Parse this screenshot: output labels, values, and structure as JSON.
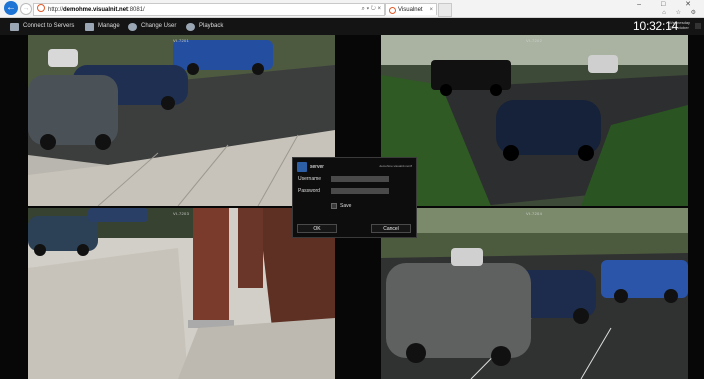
{
  "browser": {
    "url_prefix": "http://",
    "url_host": "demohme.visualnit.net",
    "url_suffix": ":8081/",
    "addr_controls": "⌕ ▾ ↻ ×",
    "tab_title": "Visualnet",
    "tab_close": "×",
    "back_glyph": "←",
    "forward_glyph": "→",
    "window_controls": "– □ ✕",
    "tool_icons": "⌂ ☆ ⚙"
  },
  "app": {
    "menu": [
      {
        "label": "Connect to Servers",
        "icon": "monitor-icon"
      },
      {
        "label": "Manage",
        "icon": "tools-icon"
      },
      {
        "label": "Change User",
        "icon": "user-icon"
      },
      {
        "label": "Playback",
        "icon": "playback-icon"
      }
    ],
    "clock": "10:32:14",
    "clock_day": "Wednesday",
    "clock_date": "05 October"
  },
  "cameras": [
    {
      "title": "VI-7201",
      "scene": "parking lot with blue pickup and cars"
    },
    {
      "title": "VI-7202",
      "scene": "parking lot with black pickup and dark SUV"
    },
    {
      "title": "VI-7203",
      "scene": "entrance walkway with brick columns"
    },
    {
      "title": "VI-7204",
      "scene": "parking lot with minivan and cars"
    }
  ],
  "login": {
    "title": "server",
    "url": "demohme.visualnit.net:8",
    "username_label": "Username",
    "password_label": "Password",
    "username_value": "",
    "password_value": "",
    "save_label": "Save",
    "ok_label": "OK",
    "cancel_label": "Cancel"
  },
  "colors": {
    "app_bar": "#141414",
    "dialog_bg": "#0d0d0d",
    "browser_back": "#1d74d4"
  }
}
